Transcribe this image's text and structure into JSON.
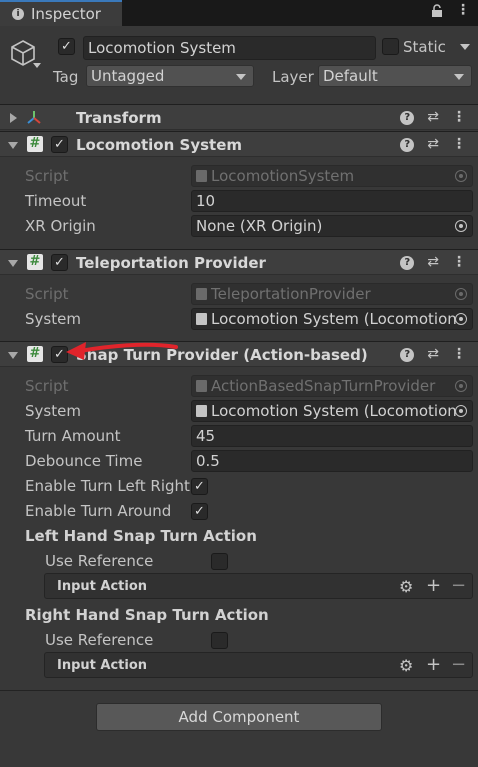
{
  "tab": {
    "title": "Inspector",
    "icon": "info-icon"
  },
  "object": {
    "active": true,
    "name": "Locomotion System",
    "static_label": "Static",
    "static_checked": false,
    "tag_label": "Tag",
    "tag_value": "Untagged",
    "layer_label": "Layer",
    "layer_value": "Default"
  },
  "transform": {
    "title": "Transform"
  },
  "locomotion_system": {
    "title": "Locomotion System",
    "enabled": true,
    "script_label": "Script",
    "script_value": "LocomotionSystem",
    "timeout_label": "Timeout",
    "timeout_value": "10",
    "xr_origin_label": "XR Origin",
    "xr_origin_value": "None (XR Origin)"
  },
  "teleportation": {
    "title": "Teleportation Provider",
    "enabled": true,
    "script_label": "Script",
    "script_value": "TeleportationProvider",
    "system_label": "System",
    "system_value": "Locomotion System (Locomotion"
  },
  "snap_turn": {
    "title": "Snap Turn Provider (Action-based)",
    "enabled": true,
    "script_label": "Script",
    "script_value": "ActionBasedSnapTurnProvider",
    "system_label": "System",
    "system_value": "Locomotion System (Locomotion",
    "turn_amount_label": "Turn Amount",
    "turn_amount_value": "45",
    "debounce_label": "Debounce Time",
    "debounce_value": "0.5",
    "enable_turn_lr_label": "Enable Turn Left Right",
    "enable_turn_lr": true,
    "enable_turn_around_label": "Enable Turn Around",
    "enable_turn_around": true,
    "left_action_title": "Left Hand Snap Turn Action",
    "left_use_ref_label": "Use Reference",
    "left_use_ref": false,
    "left_input_action": "Input Action",
    "right_action_title": "Right Hand Snap Turn Action",
    "right_use_ref_label": "Use Reference",
    "right_use_ref": false,
    "right_input_action": "Input Action"
  },
  "add_component": "Add Component",
  "annotation": {
    "type": "red-arrow",
    "color": "#e0242b",
    "points_to": "snap-turn-enabled-checkbox"
  },
  "colors": {
    "accent": "#3a79bb",
    "script_icon": "#3d8a3d",
    "arrow": "#e0242b"
  }
}
